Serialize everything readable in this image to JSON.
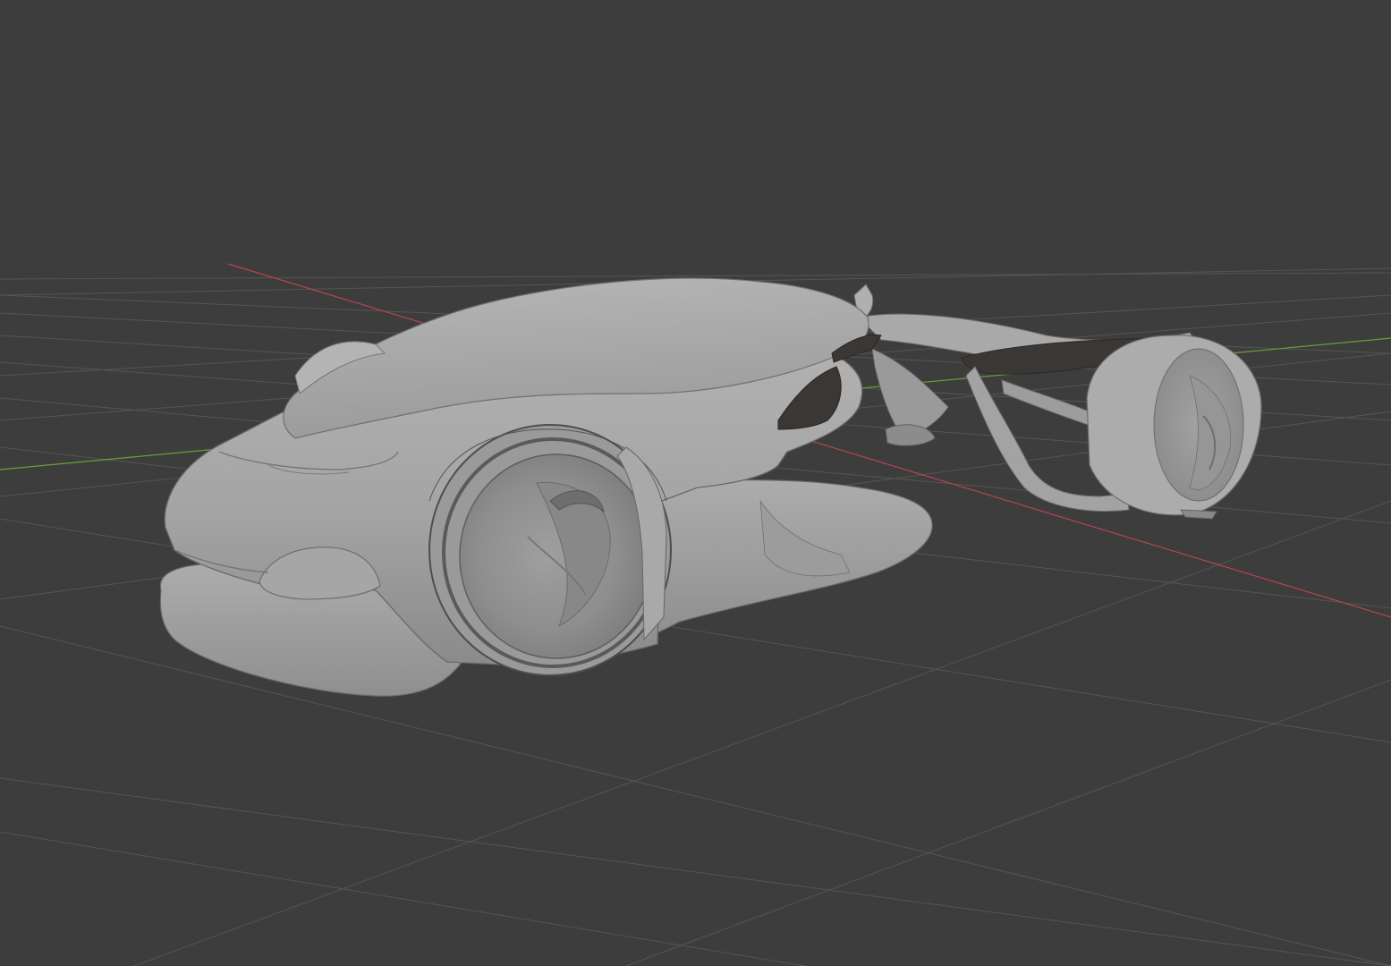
{
  "app": {
    "name": "3D viewport",
    "view": "perspective",
    "shading": "solid"
  },
  "viewport": {
    "background_color": "#3d3d3d",
    "grid": {
      "visible": true,
      "line_color": "#555555",
      "x_axis_color": "#b8444f",
      "y_axis_color": "#6e9e3a"
    },
    "object": {
      "kind": "futuristic-concept-car",
      "shading_color": "#a6a6a6"
    }
  }
}
